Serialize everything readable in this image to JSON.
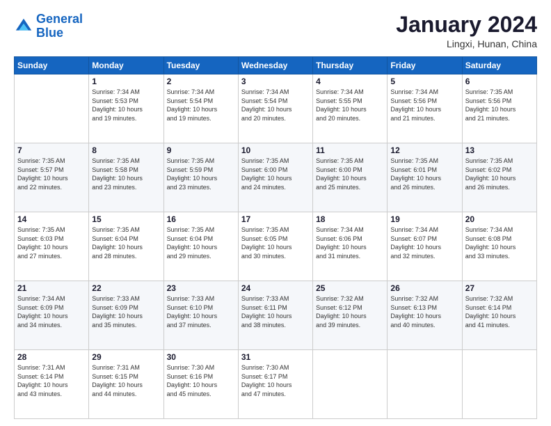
{
  "header": {
    "logo_line1": "General",
    "logo_line2": "Blue",
    "month_title": "January 2024",
    "location": "Lingxi, Hunan, China"
  },
  "days_of_week": [
    "Sunday",
    "Monday",
    "Tuesday",
    "Wednesday",
    "Thursday",
    "Friday",
    "Saturday"
  ],
  "weeks": [
    [
      {
        "day": "",
        "info": ""
      },
      {
        "day": "1",
        "info": "Sunrise: 7:34 AM\nSunset: 5:53 PM\nDaylight: 10 hours\nand 19 minutes."
      },
      {
        "day": "2",
        "info": "Sunrise: 7:34 AM\nSunset: 5:54 PM\nDaylight: 10 hours\nand 19 minutes."
      },
      {
        "day": "3",
        "info": "Sunrise: 7:34 AM\nSunset: 5:54 PM\nDaylight: 10 hours\nand 20 minutes."
      },
      {
        "day": "4",
        "info": "Sunrise: 7:34 AM\nSunset: 5:55 PM\nDaylight: 10 hours\nand 20 minutes."
      },
      {
        "day": "5",
        "info": "Sunrise: 7:34 AM\nSunset: 5:56 PM\nDaylight: 10 hours\nand 21 minutes."
      },
      {
        "day": "6",
        "info": "Sunrise: 7:35 AM\nSunset: 5:56 PM\nDaylight: 10 hours\nand 21 minutes."
      }
    ],
    [
      {
        "day": "7",
        "info": "Sunrise: 7:35 AM\nSunset: 5:57 PM\nDaylight: 10 hours\nand 22 minutes."
      },
      {
        "day": "8",
        "info": "Sunrise: 7:35 AM\nSunset: 5:58 PM\nDaylight: 10 hours\nand 23 minutes."
      },
      {
        "day": "9",
        "info": "Sunrise: 7:35 AM\nSunset: 5:59 PM\nDaylight: 10 hours\nand 23 minutes."
      },
      {
        "day": "10",
        "info": "Sunrise: 7:35 AM\nSunset: 6:00 PM\nDaylight: 10 hours\nand 24 minutes."
      },
      {
        "day": "11",
        "info": "Sunrise: 7:35 AM\nSunset: 6:00 PM\nDaylight: 10 hours\nand 25 minutes."
      },
      {
        "day": "12",
        "info": "Sunrise: 7:35 AM\nSunset: 6:01 PM\nDaylight: 10 hours\nand 26 minutes."
      },
      {
        "day": "13",
        "info": "Sunrise: 7:35 AM\nSunset: 6:02 PM\nDaylight: 10 hours\nand 26 minutes."
      }
    ],
    [
      {
        "day": "14",
        "info": "Sunrise: 7:35 AM\nSunset: 6:03 PM\nDaylight: 10 hours\nand 27 minutes."
      },
      {
        "day": "15",
        "info": "Sunrise: 7:35 AM\nSunset: 6:04 PM\nDaylight: 10 hours\nand 28 minutes."
      },
      {
        "day": "16",
        "info": "Sunrise: 7:35 AM\nSunset: 6:04 PM\nDaylight: 10 hours\nand 29 minutes."
      },
      {
        "day": "17",
        "info": "Sunrise: 7:35 AM\nSunset: 6:05 PM\nDaylight: 10 hours\nand 30 minutes."
      },
      {
        "day": "18",
        "info": "Sunrise: 7:34 AM\nSunset: 6:06 PM\nDaylight: 10 hours\nand 31 minutes."
      },
      {
        "day": "19",
        "info": "Sunrise: 7:34 AM\nSunset: 6:07 PM\nDaylight: 10 hours\nand 32 minutes."
      },
      {
        "day": "20",
        "info": "Sunrise: 7:34 AM\nSunset: 6:08 PM\nDaylight: 10 hours\nand 33 minutes."
      }
    ],
    [
      {
        "day": "21",
        "info": "Sunrise: 7:34 AM\nSunset: 6:09 PM\nDaylight: 10 hours\nand 34 minutes."
      },
      {
        "day": "22",
        "info": "Sunrise: 7:33 AM\nSunset: 6:09 PM\nDaylight: 10 hours\nand 35 minutes."
      },
      {
        "day": "23",
        "info": "Sunrise: 7:33 AM\nSunset: 6:10 PM\nDaylight: 10 hours\nand 37 minutes."
      },
      {
        "day": "24",
        "info": "Sunrise: 7:33 AM\nSunset: 6:11 PM\nDaylight: 10 hours\nand 38 minutes."
      },
      {
        "day": "25",
        "info": "Sunrise: 7:32 AM\nSunset: 6:12 PM\nDaylight: 10 hours\nand 39 minutes."
      },
      {
        "day": "26",
        "info": "Sunrise: 7:32 AM\nSunset: 6:13 PM\nDaylight: 10 hours\nand 40 minutes."
      },
      {
        "day": "27",
        "info": "Sunrise: 7:32 AM\nSunset: 6:14 PM\nDaylight: 10 hours\nand 41 minutes."
      }
    ],
    [
      {
        "day": "28",
        "info": "Sunrise: 7:31 AM\nSunset: 6:14 PM\nDaylight: 10 hours\nand 43 minutes."
      },
      {
        "day": "29",
        "info": "Sunrise: 7:31 AM\nSunset: 6:15 PM\nDaylight: 10 hours\nand 44 minutes."
      },
      {
        "day": "30",
        "info": "Sunrise: 7:30 AM\nSunset: 6:16 PM\nDaylight: 10 hours\nand 45 minutes."
      },
      {
        "day": "31",
        "info": "Sunrise: 7:30 AM\nSunset: 6:17 PM\nDaylight: 10 hours\nand 47 minutes."
      },
      {
        "day": "",
        "info": ""
      },
      {
        "day": "",
        "info": ""
      },
      {
        "day": "",
        "info": ""
      }
    ]
  ]
}
